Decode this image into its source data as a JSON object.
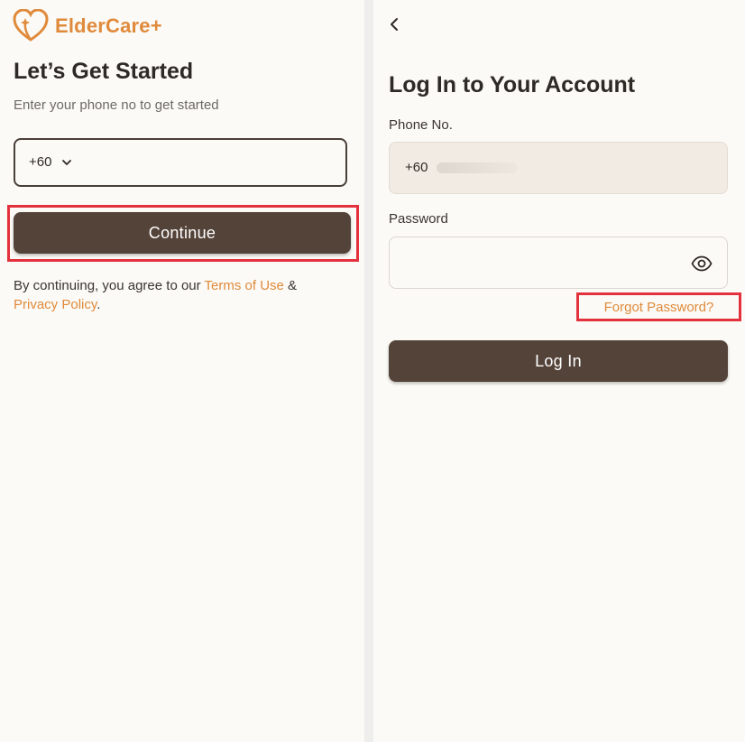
{
  "colors": {
    "brand_orange": "#e08a3b",
    "primary_button": "#544339",
    "highlight_red": "#e3323d",
    "background": "#fbfaf6"
  },
  "left": {
    "logo": {
      "text": "ElderCare+",
      "icon": "heart-logo-icon"
    },
    "title": "Let’s Get Started",
    "subtitle": "Enter your phone no to get started",
    "country_code": "+60",
    "continue_label": "Continue",
    "terms": {
      "prefix": "By continuing, you agree to our ",
      "terms_link": "Terms of Use",
      "amp": " &",
      "privacy_link": "Privacy Policy",
      "suffix": "."
    }
  },
  "right": {
    "back_icon": "chevron-left-icon",
    "title": "Log In to Your Account",
    "phone_label": "Phone No.",
    "phone_value": "+60",
    "password_label": "Password",
    "password_value": "",
    "eye_icon": "eye-icon",
    "forgot_label": "Forgot Password?",
    "login_label": "Log In"
  }
}
